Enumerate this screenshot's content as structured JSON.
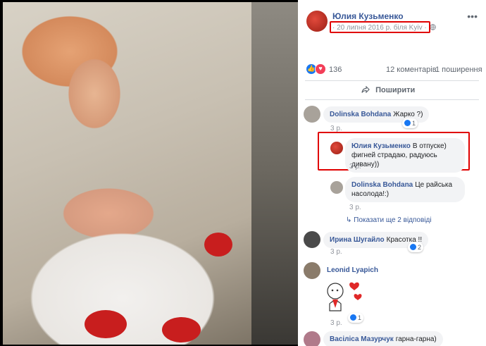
{
  "post": {
    "author": "Юлия Кузьменко",
    "meta": "· 20 липня 2016 р. біля Kyiv ·",
    "reactions_count": "136",
    "comments_count": "12 коментарів",
    "shares_count": "1 поширення",
    "share_label": "Поширити"
  },
  "icons": {
    "more": "more-options-icon",
    "globe": "globe-icon",
    "share": "share-arrow-icon",
    "like": "like-icon",
    "love": "love-icon",
    "reply": "reply-arrow-icon"
  },
  "colors": {
    "link": "#385898",
    "highlight": "#e00000",
    "like_blue": "#1877f2",
    "love_red": "#f33e58"
  },
  "comments": [
    {
      "author": "Dolinska Bohdana",
      "text": "Жарко ?)",
      "time": "3 р.",
      "likes": "1"
    },
    {
      "author": "Юлия Кузьменко",
      "text": "В отпуске) фигней страдаю, радуюсь дивану))",
      "time": "3 р."
    },
    {
      "author": "Dolinska Bohdana",
      "text": "Це райська насолода!:)",
      "time": "3 р."
    },
    {
      "show_more": "Показати ще 2 відповіді"
    },
    {
      "author": "Ирина Шугайло",
      "text": "Красотка !!",
      "time": "3 р.",
      "likes": "2"
    },
    {
      "author": "Leonid Lyapich",
      "text": "",
      "time": "3 р.",
      "likes": "1"
    },
    {
      "author": "Васіліса Мазурчук",
      "text": "гарна-гарна)"
    }
  ]
}
